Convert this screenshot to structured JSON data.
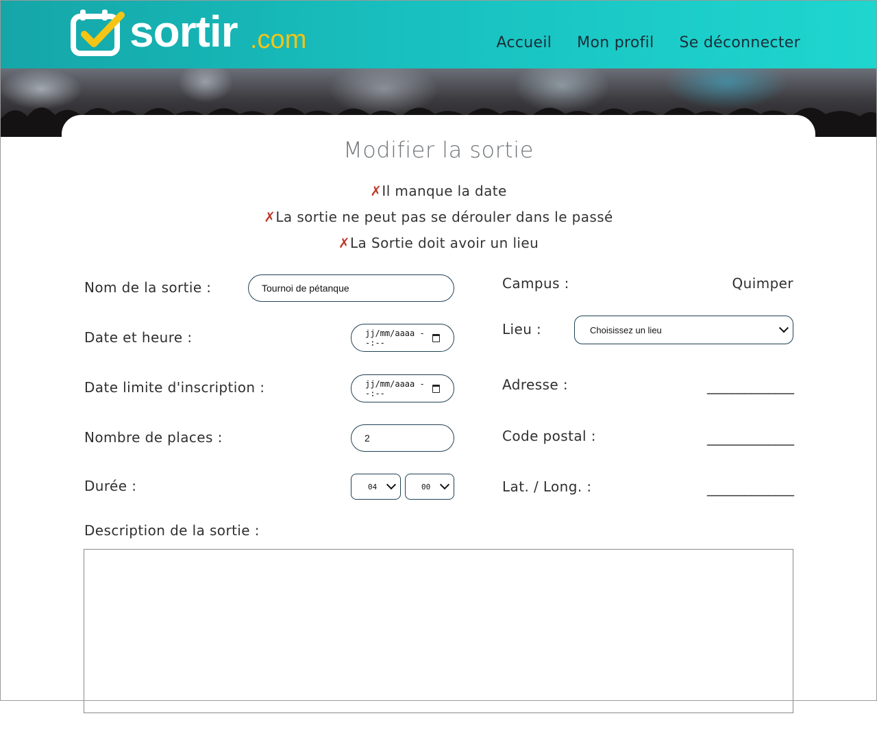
{
  "header": {
    "logo_text": "sortir",
    "logo_suffix": ".com",
    "nav": [
      "Accueil",
      "Mon profil",
      "Se déconnecter"
    ]
  },
  "page": {
    "title": "Modifier la sortie",
    "error_icon": "✗",
    "errors": [
      "Il manque la date",
      "La sortie ne peut pas se dérouler dans le passé",
      "La Sortie doit avoir un lieu"
    ]
  },
  "form": {
    "nom_label": "Nom de la sortie :",
    "nom_value": "Tournoi de pétanque",
    "date_label": "Date et heure :",
    "date_placeholder": "jj/mm/aaaa --:--",
    "limite_label": "Date limite d'inscription :",
    "limite_placeholder": "jj/mm/aaaa --:--",
    "places_label": "Nombre de places :",
    "places_value": "2",
    "duree_label": "Durée :",
    "duree_hours": "04",
    "duree_minutes": "00",
    "description_label": "Description de la sortie :",
    "campus_label": "Campus :",
    "campus_value": "Quimper",
    "lieu_label": "Lieu :",
    "lieu_selected": "Choisissez un lieu",
    "adresse_label": "Adresse :",
    "adresse_value": "______________",
    "cp_label": "Code postal :",
    "cp_value": "______________",
    "latlong_label": "Lat. / Long. :",
    "latlong_value": "______________"
  },
  "colors": {
    "header_start": "#15a6a8",
    "header_end": "#1fd6cf",
    "logo_yellow": "#f4c515",
    "error_red": "#c0392b",
    "input_border": "#1d3f52"
  }
}
